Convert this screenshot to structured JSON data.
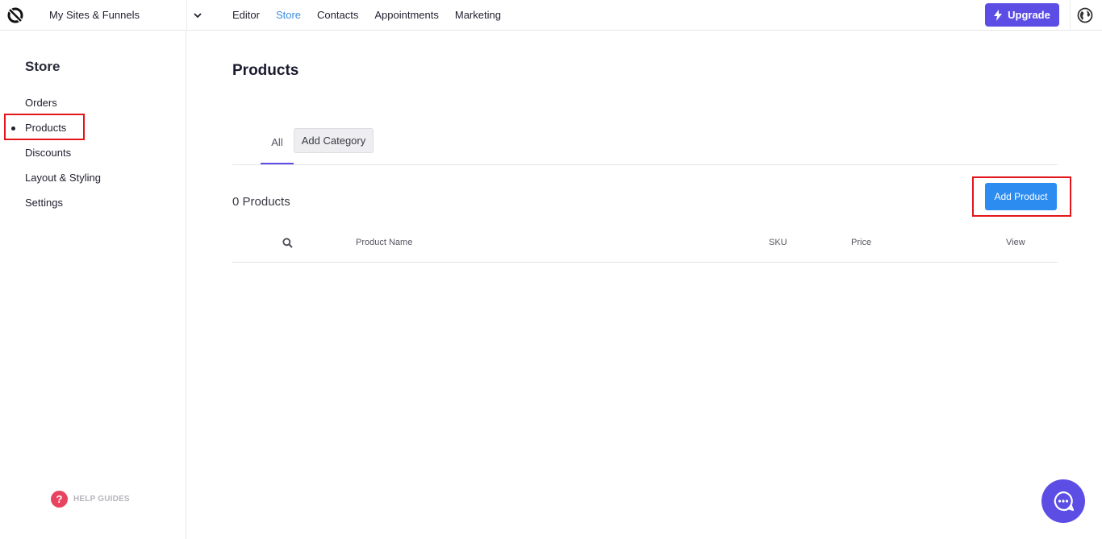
{
  "topbar": {
    "site_select": "My Sites & Funnels",
    "nav": [
      {
        "label": "Editor",
        "active": false
      },
      {
        "label": "Store",
        "active": true
      },
      {
        "label": "Contacts",
        "active": false
      },
      {
        "label": "Appointments",
        "active": false
      },
      {
        "label": "Marketing",
        "active": false
      }
    ],
    "upgrade_label": "Upgrade"
  },
  "sidebar": {
    "title": "Store",
    "items": [
      {
        "label": "Orders"
      },
      {
        "label": "Products",
        "active": true
      },
      {
        "label": "Discounts"
      },
      {
        "label": "Layout & Styling"
      },
      {
        "label": "Settings"
      }
    ],
    "help_label": "HELP GUIDES"
  },
  "main": {
    "title": "Products",
    "tabs": [
      {
        "label": "All"
      }
    ],
    "add_category_label": "Add Category",
    "count_text": "0 Products",
    "add_product_label": "Add Product",
    "table": {
      "columns": [
        "Product Name",
        "SKU",
        "Price",
        "View"
      ]
    }
  },
  "colors": {
    "accent": "#5c4ee5",
    "nav_active": "#3b8fe0",
    "primary_button": "#2d8cf0",
    "highlight": "#e3151a",
    "help_icon": "#e8445f"
  },
  "icons": [
    "logo-icon",
    "chevron-down-icon",
    "lightning-icon",
    "globe-icon",
    "search-icon",
    "question-icon",
    "chat-icon"
  ]
}
